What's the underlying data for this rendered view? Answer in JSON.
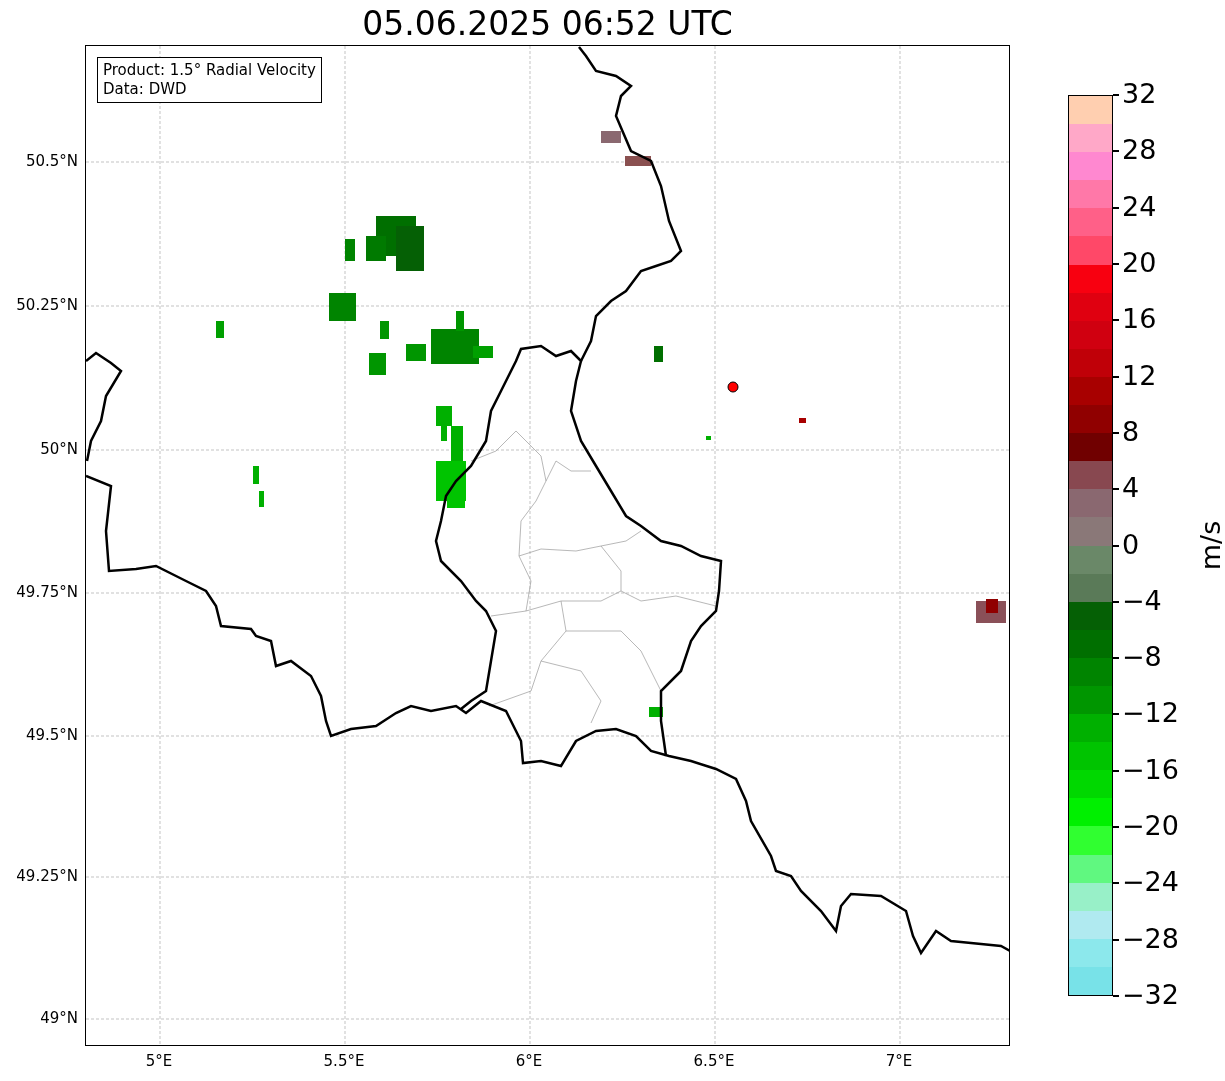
{
  "title": "05.06.2025 06:52 UTC",
  "map": {
    "info_box": [
      "Product: 1.5° Radial Velocity",
      "Data: DWD"
    ],
    "lat_ticks": [
      "50.5°N",
      "50.25°N",
      "50°N",
      "49.75°N",
      "49.5°N",
      "49.25°N",
      "49°N"
    ],
    "lon_ticks": [
      "5°E",
      "5.5°E",
      "6°E",
      "6.5°E",
      "7°E"
    ]
  },
  "colorbar": {
    "label": "m/s",
    "ticks": [
      "32",
      "28",
      "24",
      "20",
      "16",
      "12",
      "8",
      "4",
      "0",
      "−4",
      "−8",
      "−12",
      "−16",
      "−20",
      "−24",
      "−28",
      "−32"
    ],
    "bands": [
      {
        "color": "#ffcfb0"
      },
      {
        "color": "#ffa8c8"
      },
      {
        "color": "#ff88d0"
      },
      {
        "color": "#ff78a8"
      },
      {
        "color": "#ff6088"
      },
      {
        "color": "#ff4868"
      },
      {
        "color": "#f80010"
      },
      {
        "color": "#e00010"
      },
      {
        "color": "#d00010"
      },
      {
        "color": "#c00008"
      },
      {
        "color": "#a80000"
      },
      {
        "color": "#900000"
      },
      {
        "color": "#700000"
      },
      {
        "color": "#884850"
      },
      {
        "color": "#8a6870"
      },
      {
        "color": "#8a7878"
      },
      {
        "color": "#6a8868"
      },
      {
        "color": "#5a7a58"
      },
      {
        "color": "#056005"
      },
      {
        "color": "#006f00"
      },
      {
        "color": "#008400"
      },
      {
        "color": "#009600"
      },
      {
        "color": "#00b000"
      },
      {
        "color": "#00c400"
      },
      {
        "color": "#00d800"
      },
      {
        "color": "#00f000"
      },
      {
        "color": "#30ff30"
      },
      {
        "color": "#60f880"
      },
      {
        "color": "#98f0c8"
      },
      {
        "color": "#b0eaf0"
      },
      {
        "color": "#8ce8ec"
      },
      {
        "color": "#78e2e8"
      }
    ]
  }
}
